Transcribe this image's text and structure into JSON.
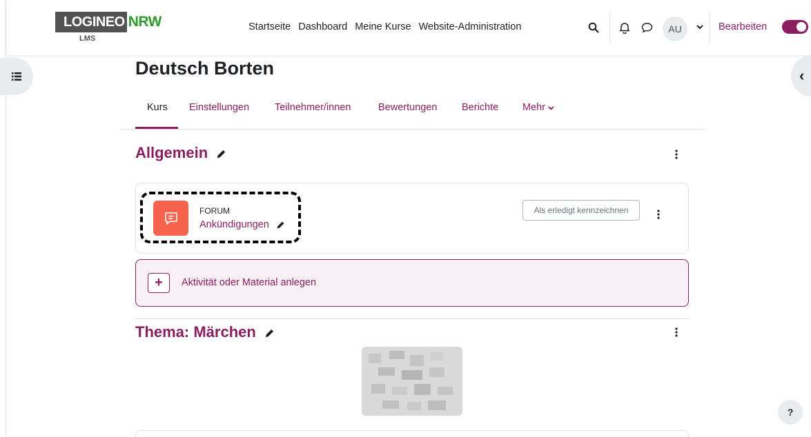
{
  "brand": {
    "logo_main": "LOGINEO",
    "logo_accent": "NRW",
    "logo_sub": "LMS"
  },
  "nav": {
    "items": [
      "Startseite",
      "Dashboard",
      "Meine Kurse",
      "Website-Administration"
    ]
  },
  "user": {
    "initials": "AU"
  },
  "edit_mode": {
    "label": "Bearbeiten",
    "enabled": true
  },
  "course": {
    "title": "Deutsch Borten"
  },
  "tabs": [
    {
      "label": "Kurs",
      "active": true
    },
    {
      "label": "Einstellungen"
    },
    {
      "label": "Teilnehmer/innen"
    },
    {
      "label": "Bewertungen"
    },
    {
      "label": "Berichte"
    },
    {
      "label": "Mehr"
    }
  ],
  "sections": [
    {
      "title": "Allgemein",
      "activity": {
        "type": "FORUM",
        "name": "Ankündigungen",
        "mark_done_label": "Als erledigt kennzeichnen"
      },
      "add_label": "Aktivität oder Material anlegen"
    },
    {
      "title": "Thema: Märchen"
    }
  ],
  "help": {
    "label": "?"
  },
  "colors": {
    "accent": "#8b1e60",
    "forum": "#f7634d",
    "logo_green": "#2f9b2f"
  }
}
